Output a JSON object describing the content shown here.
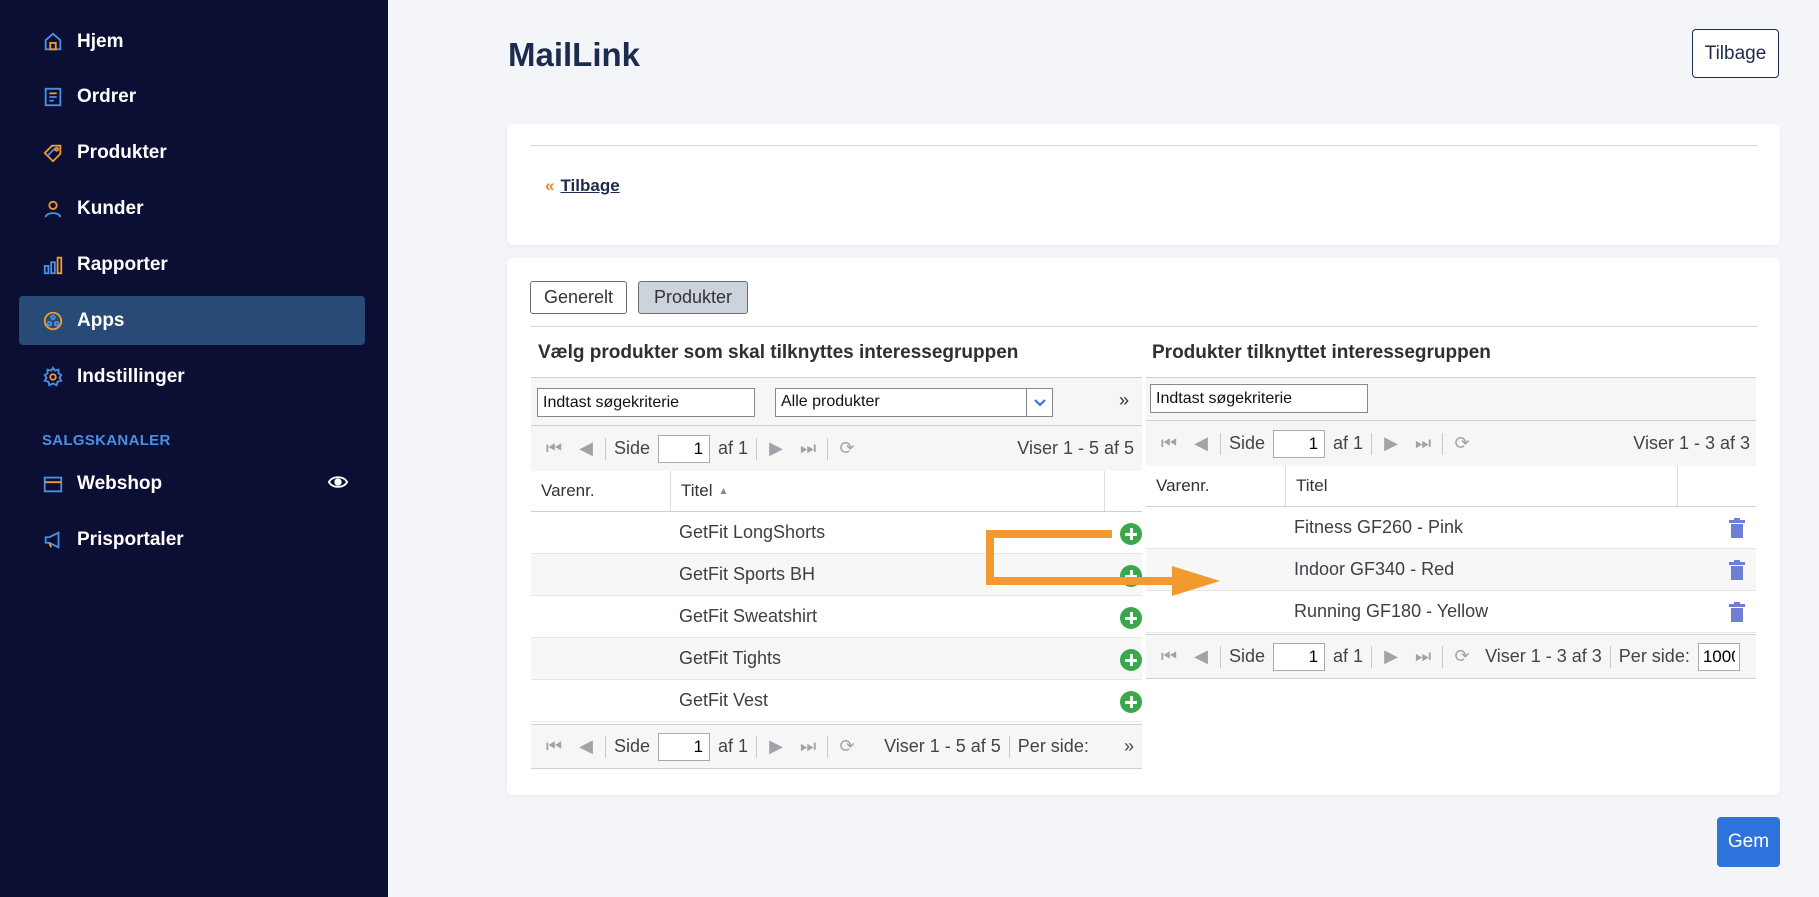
{
  "sidebar": {
    "items": [
      {
        "label": "Hjem",
        "icon": "home-icon"
      },
      {
        "label": "Ordrer",
        "icon": "orders-icon"
      },
      {
        "label": "Produkter",
        "icon": "tag-icon"
      },
      {
        "label": "Kunder",
        "icon": "user-icon"
      },
      {
        "label": "Rapporter",
        "icon": "bar-chart-icon"
      },
      {
        "label": "Apps",
        "icon": "apps-icon",
        "active": true
      },
      {
        "label": "Indstillinger",
        "icon": "gear-icon"
      }
    ],
    "section_label": "SALGSKANALER",
    "channels": [
      {
        "label": "Webshop",
        "icon": "store-icon"
      },
      {
        "label": "Prisportaler",
        "icon": "megaphone-icon"
      }
    ]
  },
  "header": {
    "title": "MailLink",
    "back_button": "Tilbage"
  },
  "breadcrumb": {
    "raquo": "«",
    "back_link": "Tilbage"
  },
  "tabs": [
    {
      "label": "Generelt",
      "active": false
    },
    {
      "label": "Produkter",
      "active": true
    }
  ],
  "left_panel": {
    "title": "Vælg produkter som skal tilknyttes interessegruppen",
    "search_value": "Indtast søgekriterie",
    "filter_value": "Alle produkter",
    "pager_top": {
      "side_label": "Side",
      "page": "1",
      "of_label": "af 1",
      "showing": "Viser 1 - 5 af 5"
    },
    "columns": [
      "Varenr.",
      "Titel"
    ],
    "rows": [
      "GetFit LongShorts",
      "GetFit Sports BH",
      "GetFit Sweatshirt",
      "GetFit Tights",
      "GetFit Vest"
    ],
    "pager_bottom": {
      "side_label": "Side",
      "page": "1",
      "of_label": "af 1",
      "showing": "Viser 1 - 5 af 5",
      "per_page_label": "Per side:"
    }
  },
  "right_panel": {
    "title": "Produkter tilknyttet interessegruppen",
    "search_value": "Indtast søgekriterie",
    "pager_top": {
      "side_label": "Side",
      "page": "1",
      "of_label": "af 1",
      "showing": "Viser 1 - 3 af 3"
    },
    "columns": [
      "Varenr.",
      "Titel"
    ],
    "rows": [
      "Fitness GF260 - Pink",
      "Indoor GF340 - Red",
      "Running GF180 - Yellow"
    ],
    "pager_bottom": {
      "side_label": "Side",
      "page": "1",
      "of_label": "af 1",
      "showing": "Viser 1 - 3 af 3",
      "per_page_label": "Per side:",
      "per_page_value": "1000"
    }
  },
  "footer": {
    "save_label": "Gem"
  },
  "colors": {
    "sidebar_bg": "#0b0f33",
    "accent_orange": "#f29a2e",
    "primary": "#2d73db",
    "add_green": "#39a84a"
  }
}
